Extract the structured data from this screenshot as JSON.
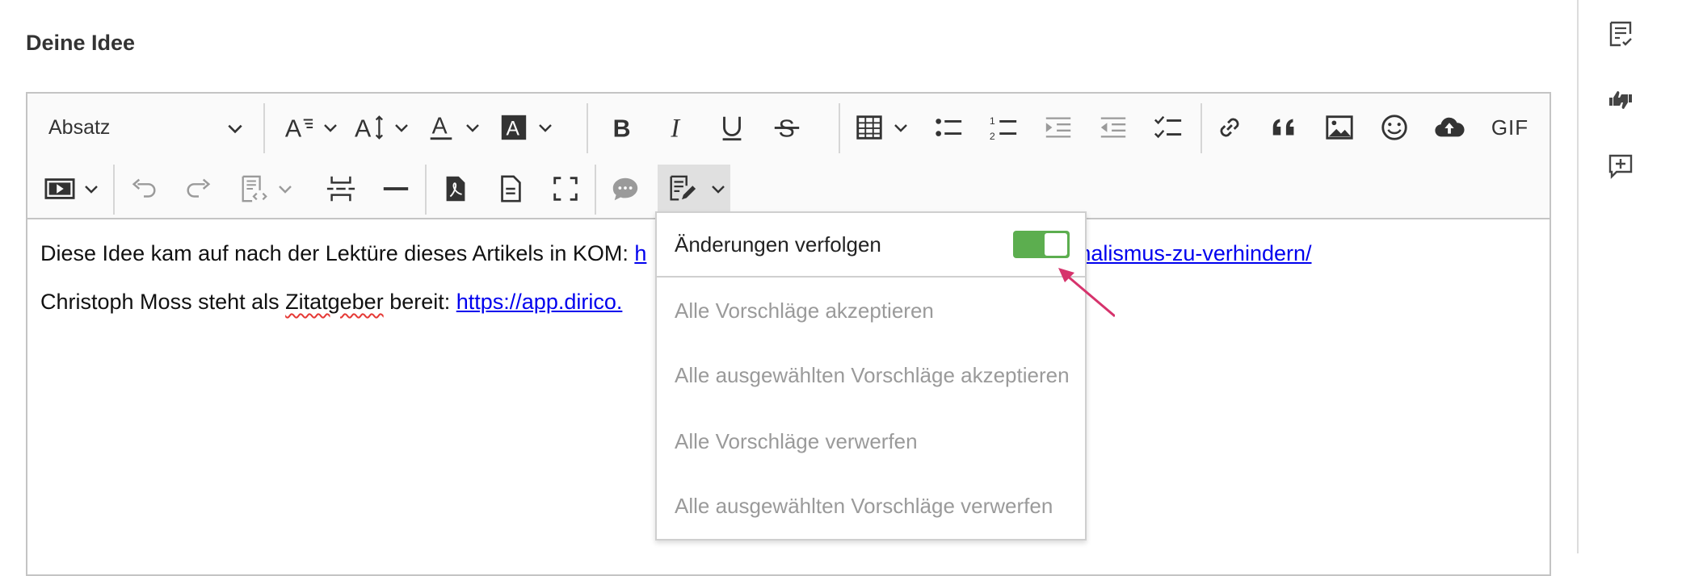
{
  "field": {
    "label": "Deine Idee"
  },
  "toolbar": {
    "heading_value": "Absatz",
    "gif_label": "GIF"
  },
  "content": {
    "p1_text": "Diese Idee kam auf nach der Lektüre dieses Artikels in KOM: ",
    "p1_link_visible": "h",
    "p1_link_tail": "rnalismus-zu-verhindern/",
    "p2_text_a": "Christoph Moss steht als ",
    "p2_spell": "Zitatgeber",
    "p2_text_b": " bereit: ",
    "p2_link": "https://app.dirico."
  },
  "track_changes_menu": {
    "toggle_label": "Änderungen verfolgen",
    "toggle_on": true,
    "items": [
      "Alle Vorschläge akzeptieren",
      "Alle ausgewählten Vorschläge akzeptieren",
      "Alle Vorschläge verwerfen",
      "Alle ausgewählten Vorschläge verwerfen"
    ]
  },
  "colors": {
    "toggle_on": "#5cae4f",
    "link": "#0000ee",
    "arrow": "#d6336c",
    "disabled_text": "#9a9a9a"
  },
  "sidebar": {
    "icons": [
      "comments-list-icon",
      "thumbs-vote-icon",
      "add-comment-icon"
    ]
  }
}
